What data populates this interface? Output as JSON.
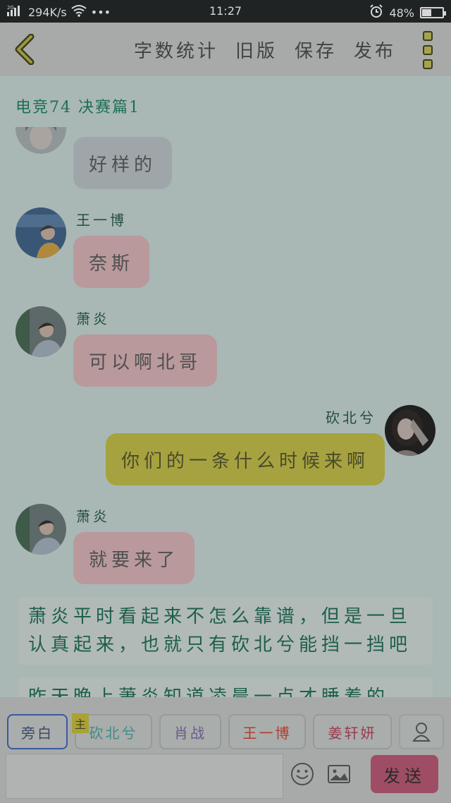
{
  "status_bar": {
    "network": "2G",
    "speed": "294K/s",
    "dots": "•••",
    "time": "11:27",
    "battery": "48%",
    "battery_level": 0.48
  },
  "toolbar": {
    "actions": [
      "字数统计",
      "旧版",
      "保存",
      "发布"
    ]
  },
  "title": "电竞74  决赛篇1",
  "messages": [
    {
      "speaker": "",
      "text": "好样的",
      "side": "left",
      "color": "grey"
    },
    {
      "speaker": "王一博",
      "text": "奈斯",
      "side": "left",
      "color": "pink"
    },
    {
      "speaker": "萧炎",
      "text": "可以啊北哥",
      "side": "left",
      "color": "pink"
    },
    {
      "speaker": "砍北兮",
      "text": "你们的一条什么时候来啊",
      "side": "right",
      "color": "yellow"
    },
    {
      "speaker": "萧炎",
      "text": "就要来了",
      "side": "left",
      "color": "pink"
    }
  ],
  "narration": [
    "萧炎平时看起来不怎么靠谱，但是一旦认真起来，也就只有砍北兮能挡一挡吧",
    "昨天晚上萧炎知道凌晨一点才睡着的"
  ],
  "characters": {
    "badge": "主",
    "chips": [
      {
        "label": "旁白",
        "color": "#3d4a66",
        "selected": true
      },
      {
        "label": "砍北兮",
        "color": "#3f8a86"
      },
      {
        "label": "肖战",
        "color": "#6a5a8c"
      },
      {
        "label": "王一博",
        "color": "#b33b2f"
      },
      {
        "label": "姜轩妍",
        "color": "#9a3a50"
      }
    ]
  },
  "input": {
    "placeholder": "",
    "send_label": "发送"
  }
}
